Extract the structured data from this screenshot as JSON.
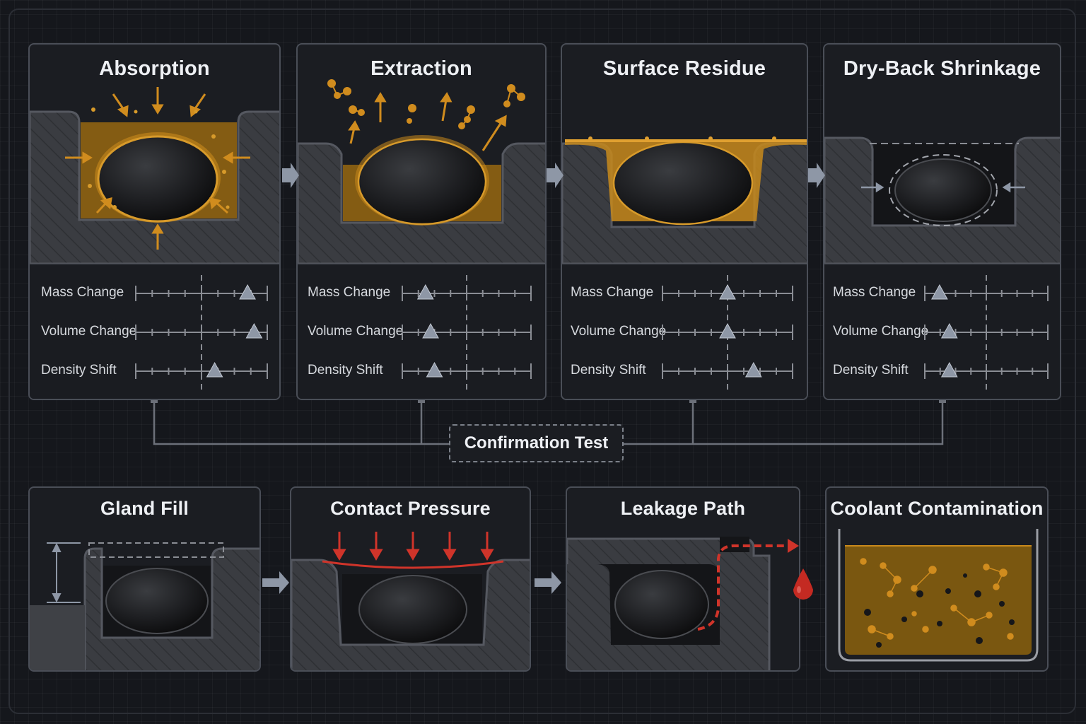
{
  "stages": [
    {
      "title": "Absorption",
      "metrics": [
        {
          "label": "Mass Change",
          "level": 0.85
        },
        {
          "label": "Volume Change",
          "level": 0.9
        },
        {
          "label": "Density Shift",
          "level": 0.6
        }
      ]
    },
    {
      "title": "Extraction",
      "metrics": [
        {
          "label": "Mass Change",
          "level": 0.18
        },
        {
          "label": "Volume Change",
          "level": 0.22
        },
        {
          "label": "Density Shift",
          "level": 0.25
        }
      ]
    },
    {
      "title": "Surface Residue",
      "metrics": [
        {
          "label": "Mass Change",
          "level": 0.5
        },
        {
          "label": "Volume Change",
          "level": 0.5
        },
        {
          "label": "Density Shift",
          "level": 0.7
        }
      ]
    },
    {
      "title": "Dry-Back Shrinkage",
      "metrics": [
        {
          "label": "Mass Change",
          "level": 0.12
        },
        {
          "label": "Volume Change",
          "level": 0.2
        },
        {
          "label": "Density Shift",
          "level": 0.2
        }
      ]
    }
  ],
  "confirmation": {
    "label": "Confirmation Test"
  },
  "effects": [
    {
      "title": "Gland Fill"
    },
    {
      "title": "Contact Pressure"
    },
    {
      "title": "Leakage Path"
    },
    {
      "title": "Coolant Contamination"
    }
  ],
  "colors": {
    "fluid": "#c8891c",
    "pressure": "#d0342a",
    "marker": "#8e97a6",
    "wire": "#6c7079",
    "panel_border": "#4a4e57"
  },
  "icons": {
    "flow_arrow": "arrow-right-icon",
    "droplet": "droplet-icon"
  }
}
